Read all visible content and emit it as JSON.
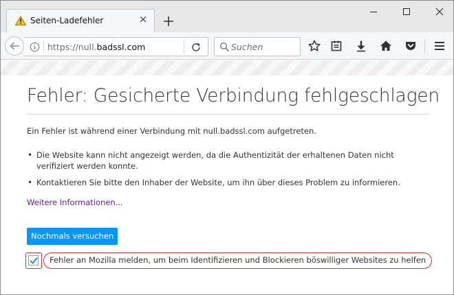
{
  "tab": {
    "title": "Seiten-Ladefehler",
    "close_glyph": "×"
  },
  "navbar": {
    "url_prefix": "https://null.",
    "url_host": "badssl.com",
    "search_placeholder": "Suchen"
  },
  "icons": {
    "tab": "warning-icon",
    "toolbar": [
      "back-arrow-icon",
      "info-icon",
      "reload-icon",
      "search-icon",
      "bookmark-star-icon",
      "reading-list-icon",
      "download-icon",
      "home-icon",
      "pocket-icon",
      "menu-icon"
    ]
  },
  "error": {
    "title": "Fehler: Gesicherte Verbindung fehlgeschlagen",
    "description": "Ein Fehler ist während einer Verbindung mit null.badssl.com aufgetreten.",
    "bullets": [
      {
        "text": "Die Website kann nicht angezeigt werden, da die Authentizität der erhaltenen Daten nicht verifiziert werden konnte."
      },
      {
        "text": "Kontaktieren Sie bitte den Inhaber der Website, um ihn über dieses Problem zu informieren."
      }
    ],
    "more_info": "Weitere Informationen...",
    "retry_label": "Nochmals versuchen",
    "report_label": "Fehler an Mozilla melden, um beim Identifizieren und Blockieren böswilliger Websites zu helfen",
    "report_checked": true
  },
  "colors": {
    "accent": "#0996f8",
    "link": "#5b2196",
    "highlight": "#d0302f",
    "warning": "#f5c211"
  }
}
